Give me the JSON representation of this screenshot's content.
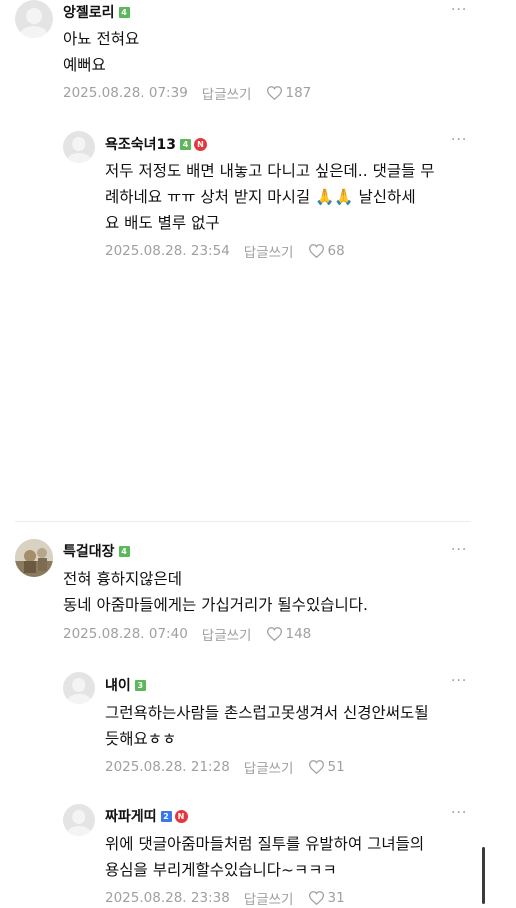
{
  "colors": {
    "badge_green": "#5cb85c",
    "badge_blue": "#3b78e7",
    "badge_red": "#e8353c",
    "meta_gray": "#a0a0a0"
  },
  "comments": [
    {
      "nick": "앙젤로리",
      "level": "4",
      "level_color": "green",
      "text_lines": [
        "아뇨 전혀요",
        "예뻐요"
      ],
      "date": "2025.08.28. 07:39",
      "reply_label": "답글쓰기",
      "likes": "187",
      "avatar_icon": "default-avatar-icon"
    },
    {
      "nick": "욕조숙녀13",
      "level": "4",
      "level_color": "green",
      "new_badge": "N",
      "text_lines": [
        "저두 저정도 배면 내놓고 다니고 싶은데.. 댓글들 무",
        "례하네요 ㅠㅠ 상처 받지 마시길 🙏🙏 날신하세",
        "요 배도 별루 없구"
      ],
      "date": "2025.08.28. 23:54",
      "reply_label": "답글쓰기",
      "likes": "68",
      "avatar_icon": "default-avatar-icon"
    },
    {
      "nick": "특걸대장",
      "level": "4",
      "level_color": "green",
      "text_lines": [
        "전혀 흉하지않은데",
        "동네 아줌마들에게는 가십거리가 될수있습니다."
      ],
      "date": "2025.08.28. 07:40",
      "reply_label": "답글쓰기",
      "likes": "148",
      "avatar_icon": "photo-avatar-icon"
    },
    {
      "nick": "냬이",
      "level": "3",
      "level_color": "green",
      "text_lines": [
        "그런욕하는사람들 촌스럽고못생겨서 신경안써도될",
        "듯해요ㅎㅎ"
      ],
      "date": "2025.08.28. 21:28",
      "reply_label": "답글쓰기",
      "likes": "51",
      "avatar_icon": "default-avatar-icon"
    },
    {
      "nick": "짜파게띠",
      "level": "2",
      "level_color": "blue",
      "new_badge": "N",
      "text_lines": [
        "위에 댓글아줌마들처럼 질투를 유발하여 그녀들의",
        "용심을 부리게할수있습니다~ㅋㅋㅋ"
      ],
      "date": "2025.08.28. 23:38",
      "reply_label": "답글쓰기",
      "likes": "31",
      "avatar_icon": "default-avatar-icon"
    }
  ],
  "more_label": "···"
}
